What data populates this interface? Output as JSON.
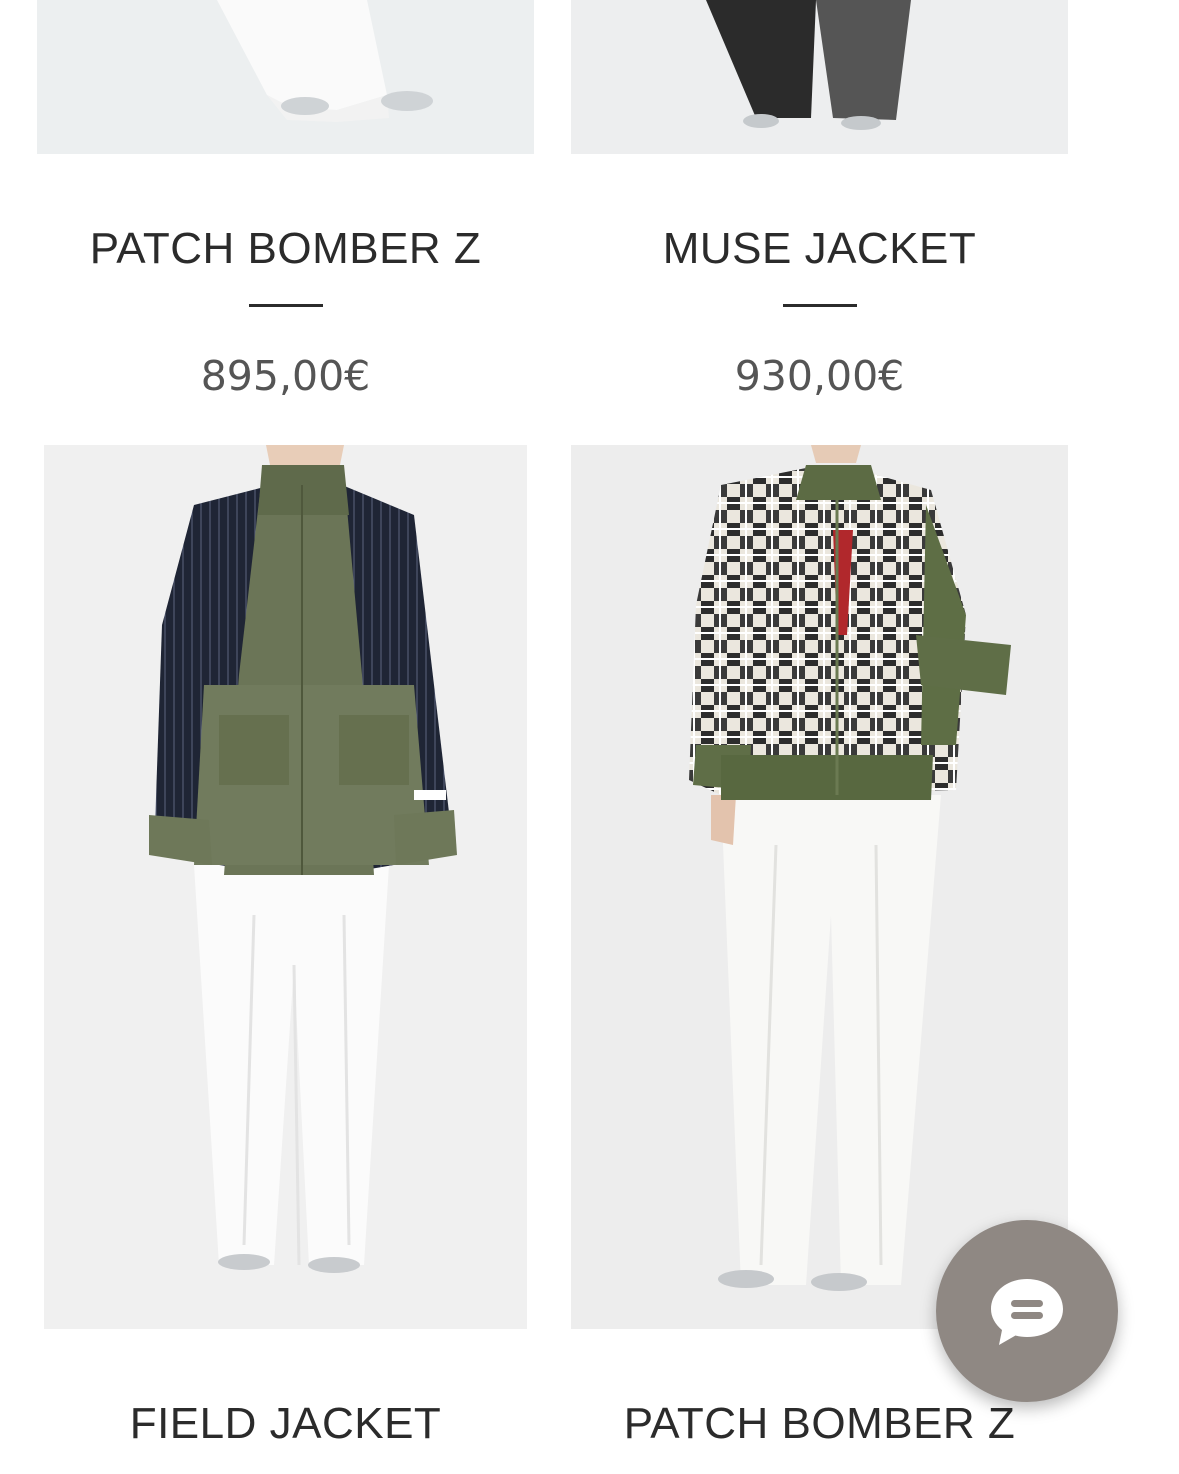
{
  "products": [
    {
      "name": "PATCH BOMBER Z",
      "price": "895,00€"
    },
    {
      "name": "MUSE JACKET",
      "price": "930,00€"
    },
    {
      "name": "FIELD JACKET"
    },
    {
      "name": "PATCH BOMBER Z"
    }
  ],
  "chat": {
    "icon": "chat-bubble-icon"
  }
}
